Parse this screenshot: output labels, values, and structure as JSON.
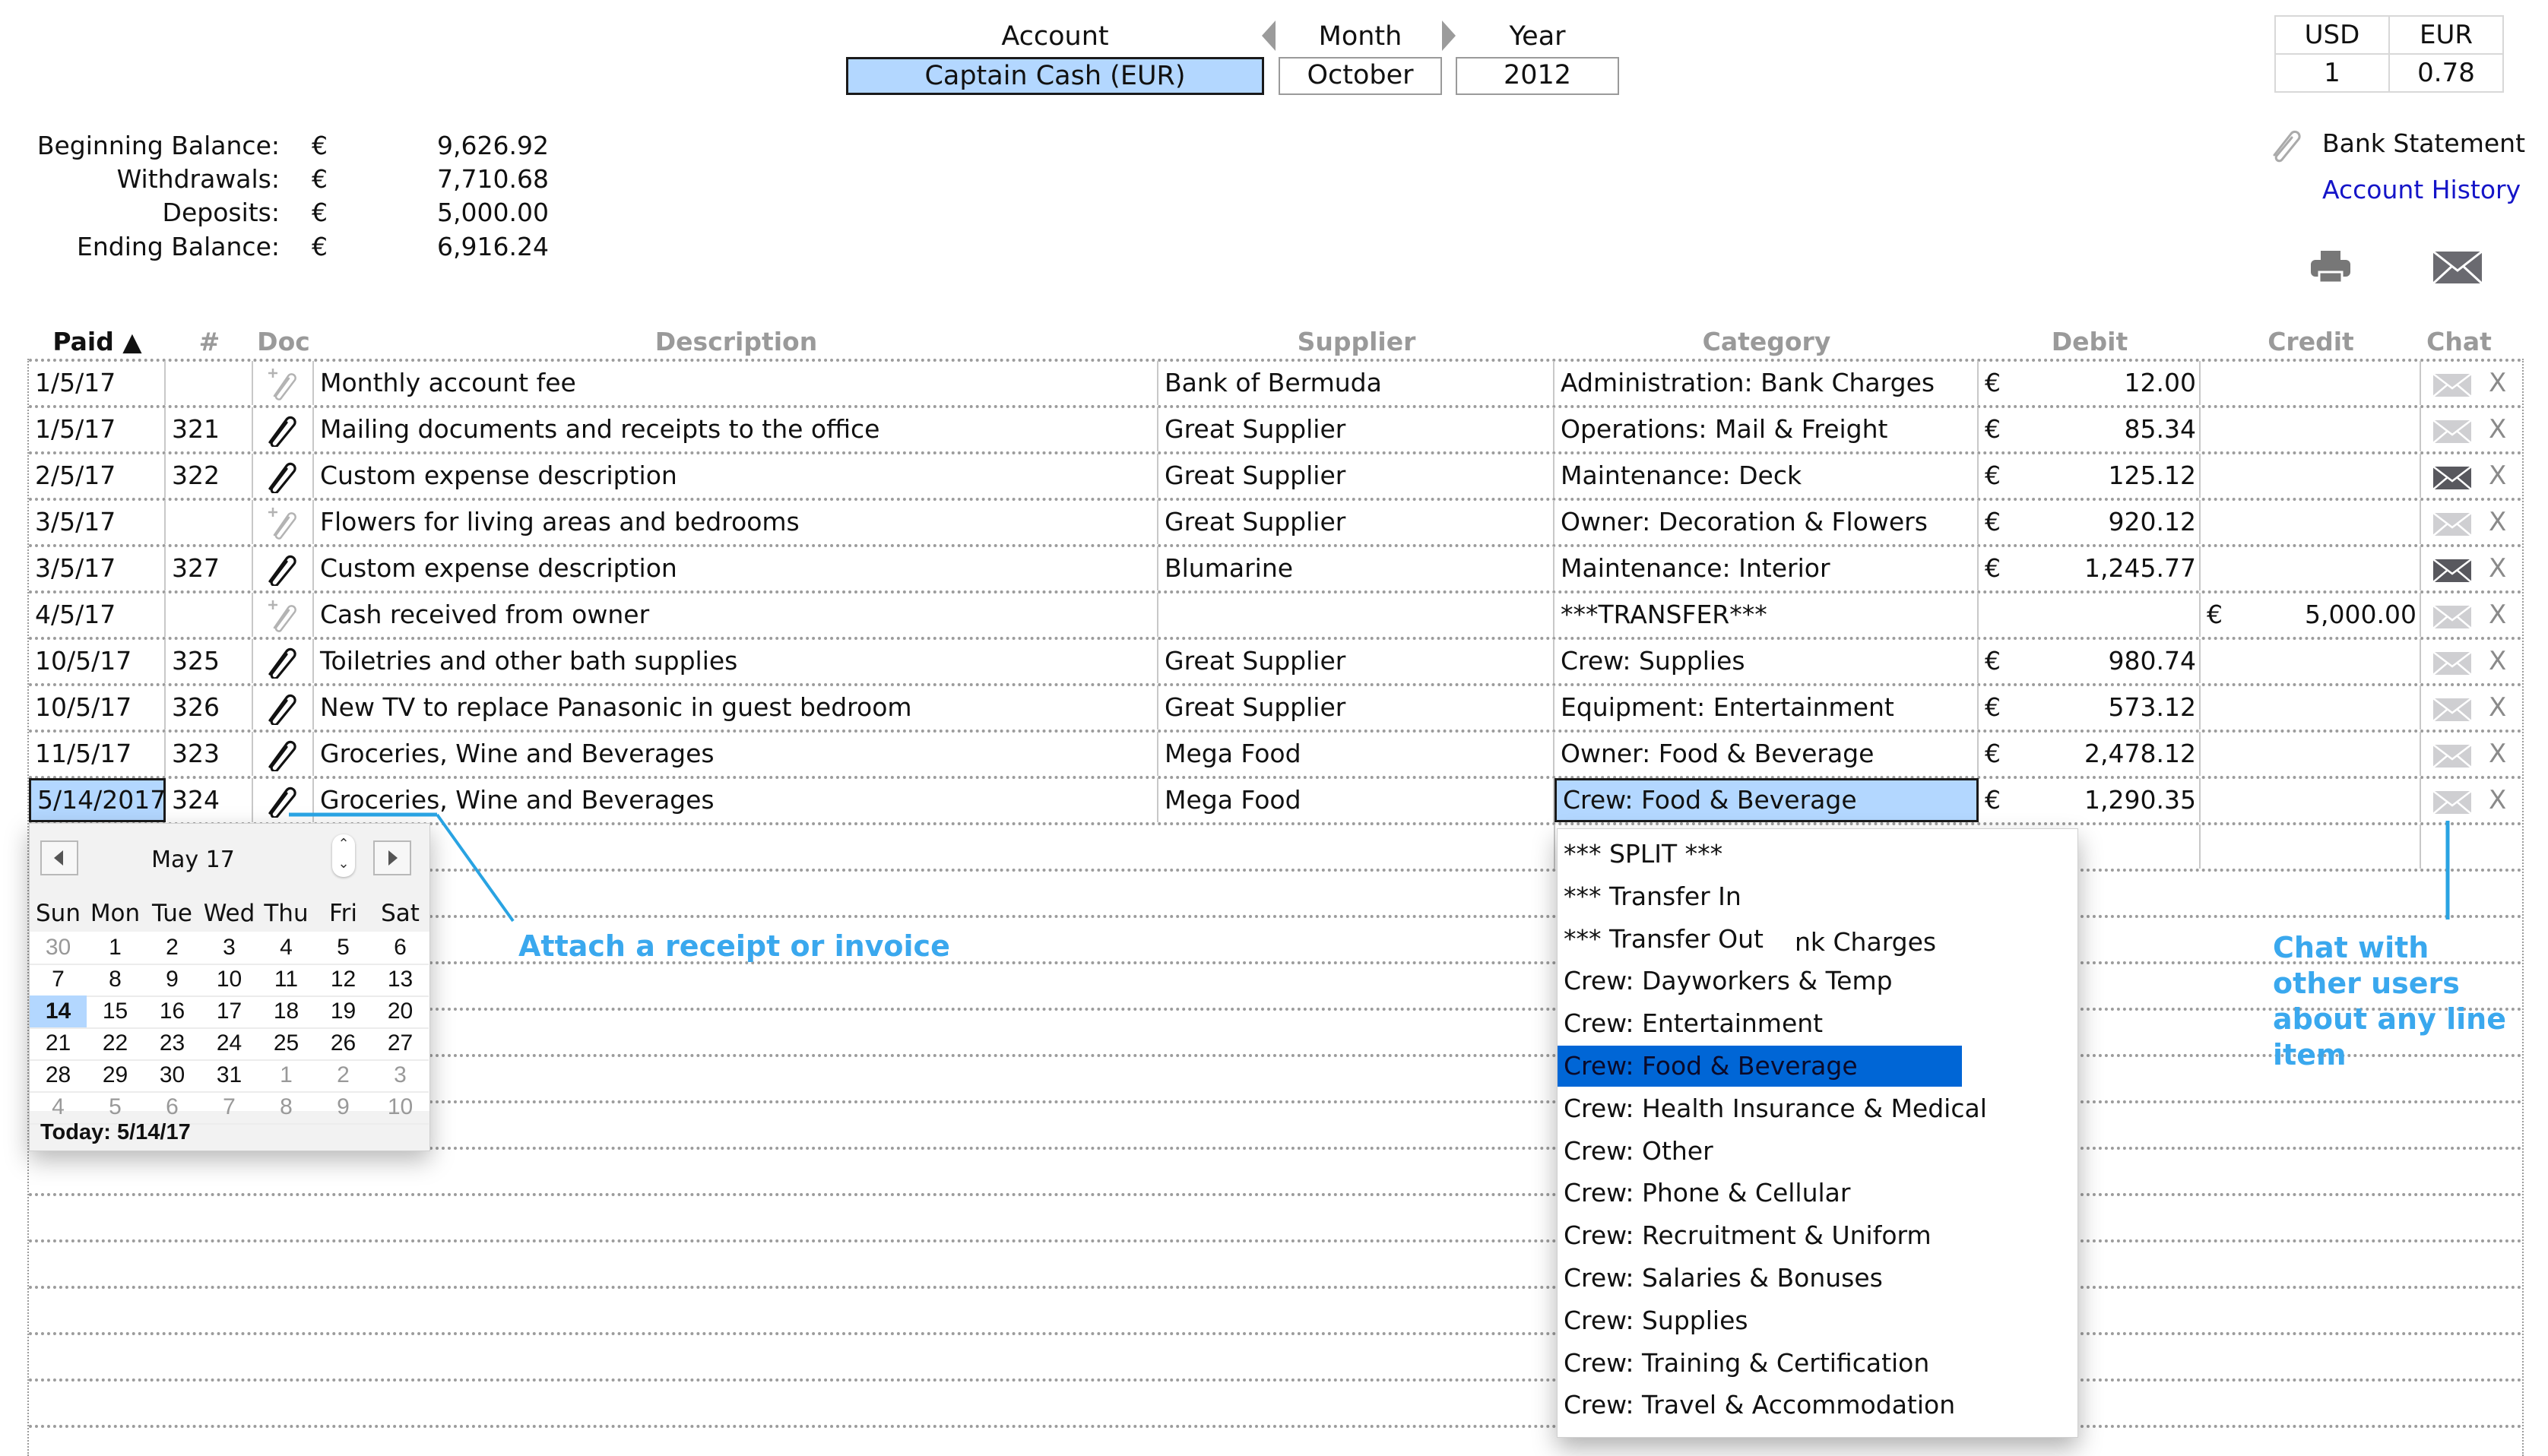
{
  "header": {
    "account_label": "Account",
    "account_value": "Captain Cash (EUR)",
    "month_label": "Month",
    "month_value": "October",
    "year_label": "Year",
    "year_value": "2012"
  },
  "fx": {
    "col1": "USD",
    "col2": "EUR",
    "val1": "1",
    "val2": "0.78"
  },
  "summary": [
    {
      "label": "Beginning Balance:",
      "currency": "€",
      "value": "9,626.92"
    },
    {
      "label": "Withdrawals:",
      "currency": "€",
      "value": "7,710.68"
    },
    {
      "label": "Deposits:",
      "currency": "€",
      "value": "5,000.00"
    },
    {
      "label": "Ending Balance:",
      "currency": "€",
      "value": "6,916.24"
    }
  ],
  "links": {
    "bank_statement": "Bank Statement",
    "account_history": "Account History"
  },
  "columns": {
    "paid": "Paid ▲",
    "num": "#",
    "doc": "Doc",
    "description": "Description",
    "supplier": "Supplier",
    "category": "Category",
    "debit": "Debit",
    "credit": "Credit",
    "chat": "Chat"
  },
  "rows": [
    {
      "paid": "1/5/17",
      "num": "",
      "doc": "add",
      "description": "Monthly account fee",
      "supplier": "Bank of Bermuda",
      "category": "Administration: Bank Charges",
      "debit_cur": "€",
      "debit": "12.00",
      "credit_cur": "",
      "credit": "",
      "chat": "none",
      "delete": "X"
    },
    {
      "paid": "1/5/17",
      "num": "321",
      "doc": "attached",
      "description": "Mailing documents and receipts to the office",
      "supplier": "Great Supplier",
      "category": "Operations: Mail & Freight",
      "debit_cur": "€",
      "debit": "85.34",
      "credit_cur": "",
      "credit": "",
      "chat": "none",
      "delete": "X"
    },
    {
      "paid": "2/5/17",
      "num": "322",
      "doc": "attached",
      "description": "Custom expense description",
      "supplier": "Great Supplier",
      "category": "Maintenance: Deck",
      "debit_cur": "€",
      "debit": "125.12",
      "credit_cur": "",
      "credit": "",
      "chat": "active",
      "delete": "X"
    },
    {
      "paid": "3/5/17",
      "num": "",
      "doc": "add",
      "description": "Flowers for living areas and bedrooms",
      "supplier": "Great Supplier",
      "category": "Owner: Decoration & Flowers",
      "debit_cur": "€",
      "debit": "920.12",
      "credit_cur": "",
      "credit": "",
      "chat": "none",
      "delete": "X"
    },
    {
      "paid": "3/5/17",
      "num": "327",
      "doc": "attached",
      "description": "Custom expense description",
      "supplier": "Blumarine",
      "category": "Maintenance: Interior",
      "debit_cur": "€",
      "debit": "1,245.77",
      "credit_cur": "",
      "credit": "",
      "chat": "active",
      "delete": "X"
    },
    {
      "paid": "4/5/17",
      "num": "",
      "doc": "add",
      "description": "Cash received from owner",
      "supplier": "",
      "category": "***TRANSFER***",
      "debit_cur": "",
      "debit": "",
      "credit_cur": "€",
      "credit": "5,000.00",
      "chat": "none",
      "delete": "X"
    },
    {
      "paid": "10/5/17",
      "num": "325",
      "doc": "attached",
      "description": "Toiletries and other bath supplies",
      "supplier": "Great Supplier",
      "category": "Crew: Supplies",
      "debit_cur": "€",
      "debit": "980.74",
      "credit_cur": "",
      "credit": "",
      "chat": "none",
      "delete": "X"
    },
    {
      "paid": "10/5/17",
      "num": "326",
      "doc": "attached",
      "description": "New TV to replace Panasonic in guest bedroom",
      "supplier": "Great Supplier",
      "category": "Equipment: Entertainment",
      "debit_cur": "€",
      "debit": "573.12",
      "credit_cur": "",
      "credit": "",
      "chat": "none",
      "delete": "X"
    },
    {
      "paid": "11/5/17",
      "num": "323",
      "doc": "attached",
      "description": "Groceries, Wine and Beverages",
      "supplier": "Mega Food",
      "category": "Owner: Food & Beverage",
      "debit_cur": "€",
      "debit": "2,478.12",
      "credit_cur": "",
      "credit": "",
      "chat": "none",
      "delete": "X"
    },
    {
      "paid": "5/14/2017",
      "num": "324",
      "doc": "attached",
      "description": "Groceries, Wine and Beverages",
      "supplier": "Mega Food",
      "category": "Crew: Food & Beverage",
      "debit_cur": "€",
      "debit": "1,290.35",
      "credit_cur": "",
      "credit": "",
      "chat": "none",
      "delete": "X"
    }
  ],
  "calendar": {
    "month_label": "May 17",
    "weekdays": [
      "Sun",
      "Mon",
      "Tue",
      "Wed",
      "Thu",
      "Fri",
      "Sat"
    ],
    "weeks": [
      [
        {
          "d": "30",
          "o": true
        },
        {
          "d": "1"
        },
        {
          "d": "2"
        },
        {
          "d": "3"
        },
        {
          "d": "4"
        },
        {
          "d": "5"
        },
        {
          "d": "6"
        }
      ],
      [
        {
          "d": "7"
        },
        {
          "d": "8"
        },
        {
          "d": "9"
        },
        {
          "d": "10"
        },
        {
          "d": "11"
        },
        {
          "d": "12"
        },
        {
          "d": "13"
        }
      ],
      [
        {
          "d": "14",
          "t": true
        },
        {
          "d": "15"
        },
        {
          "d": "16"
        },
        {
          "d": "17"
        },
        {
          "d": "18"
        },
        {
          "d": "19"
        },
        {
          "d": "20"
        }
      ],
      [
        {
          "d": "21"
        },
        {
          "d": "22"
        },
        {
          "d": "23"
        },
        {
          "d": "24"
        },
        {
          "d": "25"
        },
        {
          "d": "26"
        },
        {
          "d": "27"
        }
      ],
      [
        {
          "d": "28"
        },
        {
          "d": "29"
        },
        {
          "d": "30"
        },
        {
          "d": "31"
        },
        {
          "d": "1",
          "o": true
        },
        {
          "d": "2",
          "o": true
        },
        {
          "d": "3",
          "o": true
        }
      ],
      [
        {
          "d": "4",
          "o": true
        },
        {
          "d": "5",
          "o": true
        },
        {
          "d": "6",
          "o": true
        },
        {
          "d": "7",
          "o": true
        },
        {
          "d": "8",
          "o": true
        },
        {
          "d": "9",
          "o": true
        },
        {
          "d": "10",
          "o": true
        }
      ]
    ],
    "today_label": "Today: 5/14/17"
  },
  "category_dropdown": {
    "selected": "Crew: Food & Beverage",
    "ghost_text": "nk Charges",
    "options": [
      "*** SPLIT ***",
      "*** Transfer In",
      "*** Transfer Out",
      "Crew: Dayworkers & Temp",
      "Crew: Entertainment",
      "Crew: Food & Beverage",
      "Crew: Health Insurance & Medical",
      "Crew: Other",
      "Crew: Phone & Cellular",
      "Crew: Recruitment & Uniform",
      "Crew: Salaries & Bonuses",
      "Crew: Supplies",
      "Crew: Training & Certification",
      "Crew: Travel & Accommodation"
    ]
  },
  "annotations": {
    "attach": "Attach a receipt or invoice",
    "chat": "Chat with other users about any line item"
  },
  "colors": {
    "selection_blue": "#b3d7ff",
    "menu_highlight": "#0066d6",
    "annotation": "#3aa8ee",
    "link": "#1515c8"
  }
}
